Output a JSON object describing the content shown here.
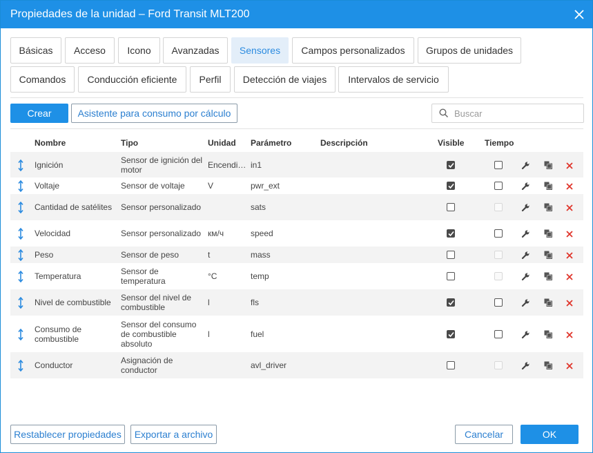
{
  "window": {
    "title": "Propiedades de la unidad – Ford Transit MLT200"
  },
  "tabs": [
    {
      "label": "Básicas"
    },
    {
      "label": "Acceso"
    },
    {
      "label": "Icono"
    },
    {
      "label": "Avanzadas"
    },
    {
      "label": "Sensores",
      "active": true
    },
    {
      "label": "Campos personalizados"
    },
    {
      "label": "Grupos de unidades"
    },
    {
      "label": "Comandos"
    },
    {
      "label": "Conducción eficiente"
    },
    {
      "label": "Perfil"
    },
    {
      "label": "Detección de viajes"
    },
    {
      "label": "Intervalos de servicio"
    }
  ],
  "toolbar": {
    "create_label": "Crear",
    "wizard_label": "Asistente para consumo por cálculo",
    "search_placeholder": "Buscar"
  },
  "table": {
    "columns": [
      "Nombre",
      "Tipo",
      "Unidad",
      "Parámetro",
      "Descripción",
      "Visible",
      "Tiempo"
    ],
    "rows": [
      {
        "name": "Ignición",
        "type": "Sensor de ignición del motor",
        "unit": "Encendi…",
        "param": "in1",
        "desc": "",
        "visible": true,
        "time": false,
        "time_enabled": true
      },
      {
        "name": "Voltaje",
        "type": "Sensor de voltaje",
        "unit": "V",
        "param": "pwr_ext",
        "desc": "",
        "visible": true,
        "time": false,
        "time_enabled": true
      },
      {
        "name": "Cantidad de satélites",
        "type": "Sensor personalizado",
        "unit": "",
        "param": "sats",
        "desc": "",
        "visible": false,
        "time": false,
        "time_enabled": false
      },
      {
        "name": "Velocidad",
        "type": "Sensor personalizado",
        "unit": "км/ч",
        "param": "speed",
        "desc": "",
        "visible": true,
        "time": false,
        "time_enabled": true
      },
      {
        "name": "Peso",
        "type": "Sensor de peso",
        "unit": "t",
        "param": "mass",
        "desc": "",
        "visible": false,
        "time": false,
        "time_enabled": false
      },
      {
        "name": "Temperatura",
        "type": "Sensor de temperatura",
        "unit": "°C",
        "param": "temp",
        "desc": "",
        "visible": false,
        "time": false,
        "time_enabled": false
      },
      {
        "name": "Nivel de combustible",
        "type": "Sensor del nivel de combustible",
        "unit": "l",
        "param": "fls",
        "desc": "",
        "visible": true,
        "time": false,
        "time_enabled": true
      },
      {
        "name": "Consumo de combustible",
        "type": "Sensor del consumo de combustible absoluto",
        "unit": "l",
        "param": "fuel",
        "desc": "",
        "visible": true,
        "time": false,
        "time_enabled": true
      },
      {
        "name": "Conductor",
        "type": "Asignación de conductor",
        "unit": "",
        "param": "avl_driver",
        "desc": "",
        "visible": false,
        "time": false,
        "time_enabled": false
      }
    ]
  },
  "footer": {
    "reset_label": "Restablecer propiedades",
    "export_label": "Exportar a archivo",
    "cancel_label": "Cancelar",
    "ok_label": "OK"
  },
  "colors": {
    "accent": "#1e90e6",
    "delete": "#e0352b",
    "active_tab_bg": "#e3eef9"
  },
  "icons": {
    "row_handle": "vertical-arrows-icon",
    "edit": "wrench-icon",
    "copy": "copy-icon",
    "delete": "close-x-icon",
    "search": "search-icon",
    "close": "close-icon"
  }
}
